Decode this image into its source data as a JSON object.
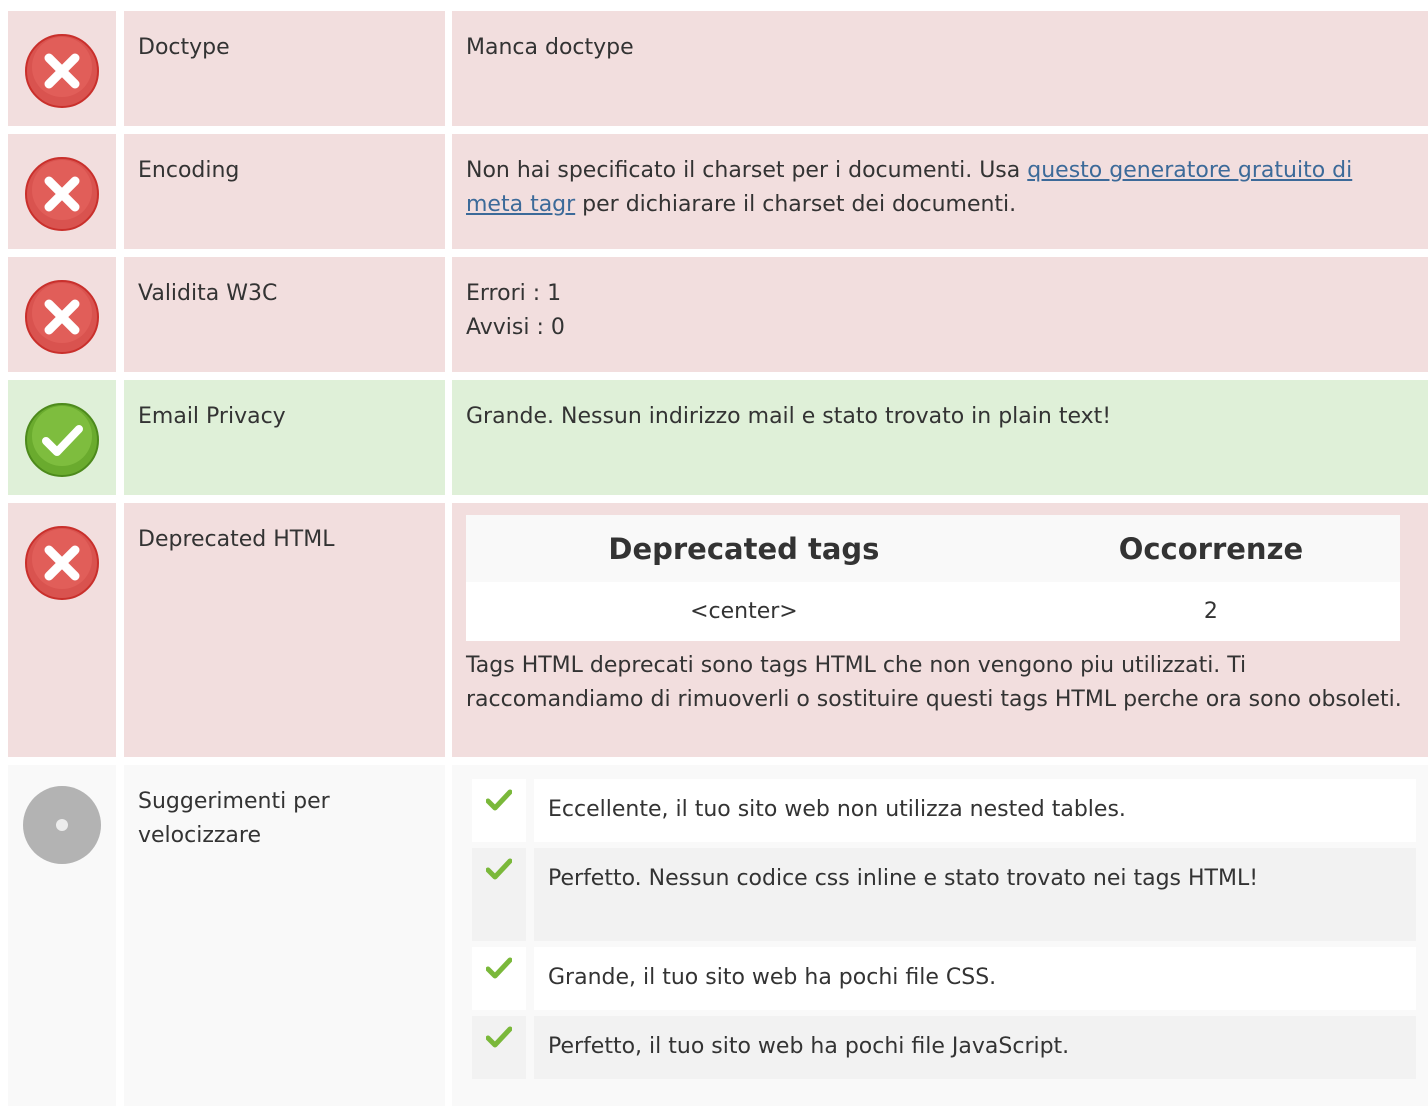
{
  "colors": {
    "error_bg": "#f2dede",
    "ok_bg": "#dff0d8",
    "neutral_bg": "#f9f9f9",
    "link": "#3c6a99",
    "check_green": "#7ab83a",
    "error_red": "#d9534f"
  },
  "rows": [
    {
      "status": "error",
      "icon": "error-x-icon",
      "label": "Doctype",
      "text": "Manca doctype"
    },
    {
      "status": "error",
      "icon": "error-x-icon",
      "label": "Encoding",
      "text_before": "Non hai specificato il charset per i documenti. Usa ",
      "link": "questo generatore gratuito di meta tagr",
      "text_after": " per dichiarare il charset dei documenti."
    },
    {
      "status": "error",
      "icon": "error-x-icon",
      "label": "Validita W3C",
      "line1": "Errori : 1",
      "line2": "Avvisi : 0"
    },
    {
      "status": "ok",
      "icon": "success-check-icon",
      "label": "Email Privacy",
      "text": "Grande. Nessun indirizzo mail e stato trovato in plain text!"
    },
    {
      "status": "error",
      "icon": "error-x-icon",
      "label": "Deprecated HTML",
      "table": {
        "headers": [
          "Deprecated tags",
          "Occorrenze"
        ],
        "rows": [
          [
            "<center>",
            "2"
          ]
        ]
      },
      "description": "Tags HTML deprecati sono tags HTML che non vengono piu utilizzati. Ti raccomandiamo di rimuoverli o sostituire questi tags HTML perche ora sono obsoleti."
    },
    {
      "status": "neutral",
      "icon": "neutral-circle-icon",
      "label": "Suggerimenti per velocizzare",
      "tips": [
        {
          "icon": "check-icon",
          "text": "Eccellente, il tuo sito web non utilizza nested tables."
        },
        {
          "icon": "check-icon",
          "text": "Perfetto. Nessun codice css inline e stato trovato nei tags HTML!"
        },
        {
          "icon": "check-icon",
          "text": "Grande, il tuo sito web ha pochi file CSS."
        },
        {
          "icon": "check-icon",
          "text": "Perfetto, il tuo sito web ha pochi file JavaScript."
        }
      ]
    }
  ]
}
